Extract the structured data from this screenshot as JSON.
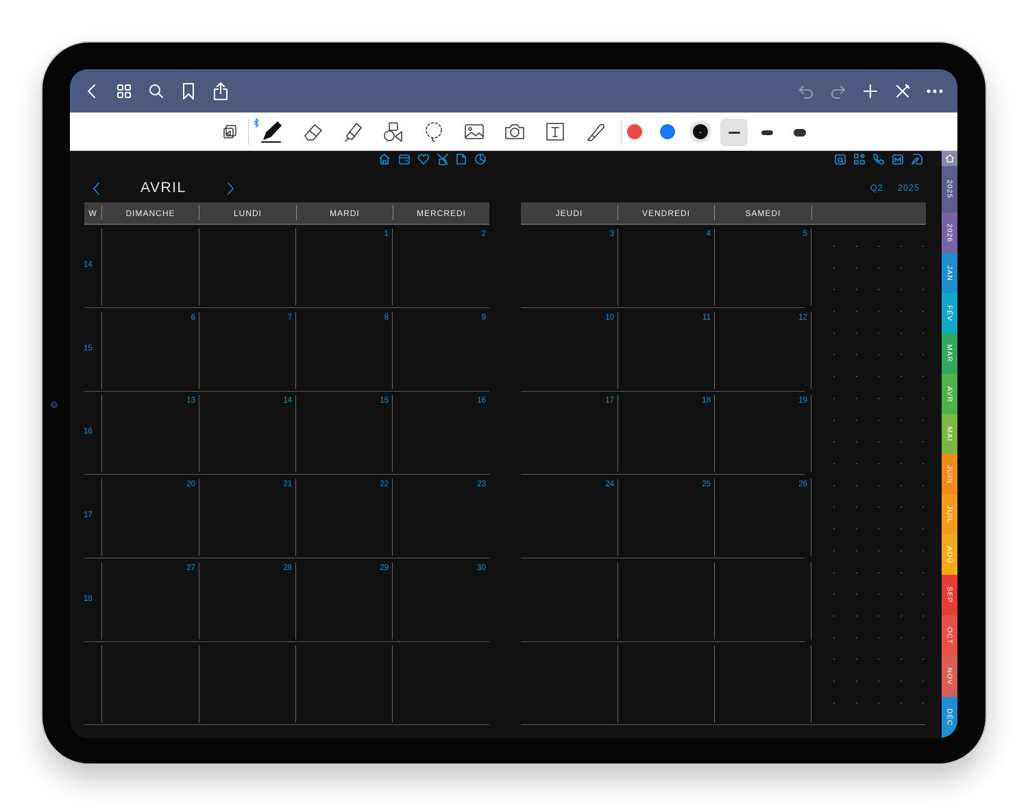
{
  "colors": {
    "accent": "#1f8fd0",
    "nav_bg": "#4d5a80",
    "page_bg": "#121212",
    "header_bg": "#3f3f3f"
  },
  "navbar": {
    "left_icons": [
      "back-chevron-icon",
      "grid-icon",
      "search-icon",
      "bookmark-icon",
      "share-icon"
    ],
    "right_icons": [
      "undo-icon",
      "redo-icon",
      "plus-icon",
      "close-pen-icon",
      "more-icon"
    ]
  },
  "toolbar": {
    "tools": [
      "read-only-icon",
      "pen-icon",
      "eraser-icon",
      "highlighter-icon",
      "shapes-icon",
      "lasso-icon",
      "image-icon",
      "camera-icon",
      "text-box-icon",
      "elements-icon"
    ],
    "bluetooth_icon": "bluetooth-icon",
    "pen_colors": [
      "#ef4a4a",
      "#1877f2",
      "#111111"
    ],
    "stroke_widths": [
      "thin",
      "medium",
      "thick"
    ]
  },
  "planner": {
    "top_icons_left": [
      "home-icon",
      "calendar-box-icon",
      "heart-icon",
      "habit-icon",
      "notes-page-icon",
      "pie-chart-icon"
    ],
    "top_icons_right": [
      "quarter-icon",
      "grid-apps-icon",
      "phone-icon",
      "month-icon",
      "edit-page-icon"
    ],
    "month": "AVRIL",
    "quarter": "Q2",
    "year": "2025",
    "week_label": "W",
    "left_days": [
      "DIMANCHE",
      "LUNDI",
      "MARDI",
      "MERCREDI"
    ],
    "right_days": [
      "JEUDI",
      "VENDREDI",
      "SAMEDI"
    ],
    "weeks": [
      "14",
      "15",
      "16",
      "17",
      "18",
      ""
    ],
    "rows_left": [
      [
        "",
        "",
        "1",
        "2"
      ],
      [
        "6",
        "7",
        "8",
        "9"
      ],
      [
        "13",
        "14",
        "15",
        "16"
      ],
      [
        "20",
        "21",
        "22",
        "23"
      ],
      [
        "27",
        "28",
        "29",
        "30"
      ],
      [
        "",
        "",
        "",
        ""
      ]
    ],
    "rows_right": [
      [
        "3",
        "4",
        "5"
      ],
      [
        "10",
        "11",
        "12"
      ],
      [
        "17",
        "18",
        "19"
      ],
      [
        "24",
        "25",
        "26"
      ],
      [
        "",
        "",
        ""
      ],
      [
        "",
        "",
        ""
      ]
    ]
  },
  "tabs": [
    {
      "label": "",
      "icon": "home-icon",
      "color": "#8a8aa8"
    },
    {
      "label": "2025",
      "color": "#5c5f8e"
    },
    {
      "label": "2026",
      "color": "#7a62a6"
    },
    {
      "label": "JAN",
      "color": "#1f8fd0"
    },
    {
      "label": "FÉV",
      "color": "#13a7c9"
    },
    {
      "label": "MAR",
      "color": "#31a85d"
    },
    {
      "label": "AVR",
      "color": "#4eb24a"
    },
    {
      "label": "MAI",
      "color": "#7ab842"
    },
    {
      "label": "JUIN",
      "color": "#f08a1c"
    },
    {
      "label": "JUIL",
      "color": "#f59b1b"
    },
    {
      "label": "AOÛ",
      "color": "#f3a91a"
    },
    {
      "label": "SEP",
      "color": "#e73f35"
    },
    {
      "label": "OCT",
      "color": "#e6524a"
    },
    {
      "label": "NOV",
      "color": "#d95d55"
    },
    {
      "label": "DÉC",
      "color": "#1f8fd0"
    }
  ]
}
